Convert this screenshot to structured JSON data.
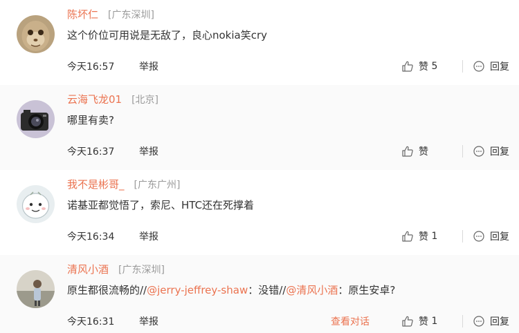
{
  "comments": [
    {
      "username": "陈坏仁",
      "location": "[广东深圳]",
      "text": "这个价位可用说是无敌了，良心nokia笑cry",
      "time": "今天16:57",
      "report": "举报",
      "like_label": "赞",
      "like_count": "5",
      "reply_label": "回复"
    },
    {
      "username": "云海飞龙01",
      "location": "[北京]",
      "text": "哪里有卖?",
      "time": "今天16:37",
      "report": "举报",
      "like_label": "赞",
      "like_count": "",
      "reply_label": "回复"
    },
    {
      "username": "我不是彬哥_",
      "location": "[广东广州]",
      "text": "诺基亚都觉悟了，索尼、HTC还在死撑着",
      "time": "今天16:34",
      "report": "举报",
      "like_label": "赞",
      "like_count": "1",
      "reply_label": "回复"
    },
    {
      "username": "清风小酒",
      "location": "[广东深圳]",
      "text_prefix": "原生都很流畅的//",
      "mention1": "@jerry-jeffrey-shaw",
      "text_middle": "：没错//",
      "mention2": "@清风小酒",
      "text_suffix": "：原生安卓?",
      "time": "今天16:31",
      "report": "举报",
      "view_conversation": "查看对话",
      "like_label": "赞",
      "like_count": "1",
      "reply_label": "回复"
    }
  ],
  "colors": {
    "accent": "#eb7350",
    "text": "#333333",
    "muted": "#999999",
    "divider": "#e6e6e6"
  },
  "icons": {
    "avatar_1": "monkey-avatar",
    "avatar_2": "camera-avatar",
    "avatar_3": "cartoon-avatar",
    "avatar_4": "photo-avatar",
    "like": "thumbs-up-icon",
    "reply": "speech-bubble-icon"
  }
}
